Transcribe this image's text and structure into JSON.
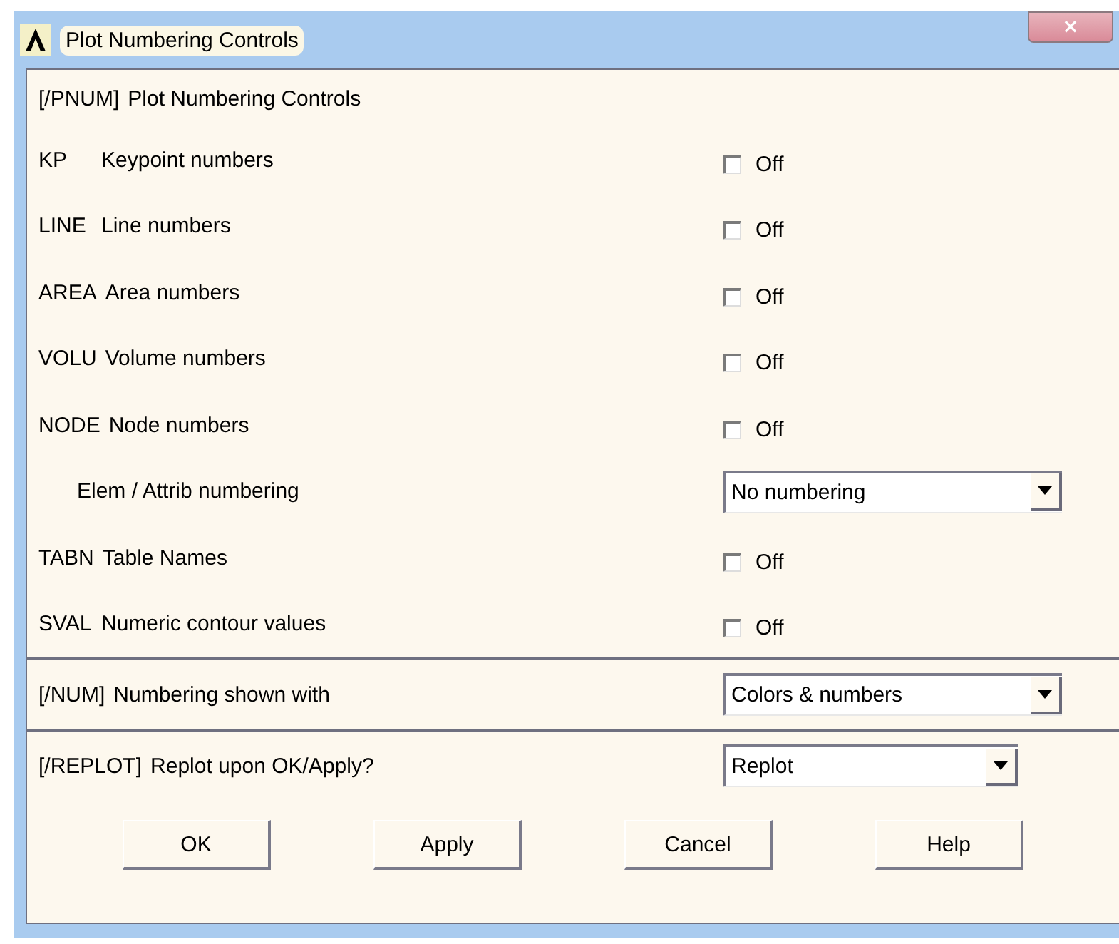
{
  "window": {
    "title": "Plot Numbering Controls",
    "close": "×"
  },
  "sections": [
    {
      "rows": [
        {
          "kind": "heading",
          "code": "[/PNUM]",
          "label": "Plot Numbering Controls"
        },
        {
          "kind": "checkbox",
          "code": "KP",
          "label": "Keypoint numbers",
          "checked": false,
          "text": "Off"
        },
        {
          "kind": "checkbox",
          "code": "LINE",
          "label": "Line numbers",
          "checked": false,
          "text": "Off"
        },
        {
          "kind": "checkbox",
          "code": "AREA",
          "label": "Area numbers",
          "checked": false,
          "text": "Off"
        },
        {
          "kind": "checkbox",
          "code": "VOLU",
          "label": "Volume numbers",
          "checked": false,
          "text": "Off"
        },
        {
          "kind": "checkbox",
          "code": "NODE",
          "label": "Node numbers",
          "checked": false,
          "text": "Off"
        },
        {
          "kind": "dropdown",
          "label": "Elem / Attrib numbering",
          "value": "No numbering"
        },
        {
          "kind": "checkbox",
          "code": "TABN",
          "label": "Table Names",
          "checked": false,
          "text": "Off"
        },
        {
          "kind": "checkbox",
          "code": "SVAL",
          "label": "Numeric contour values",
          "checked": false,
          "text": "Off"
        }
      ]
    },
    {
      "rows": [
        {
          "kind": "dropdown",
          "code": "[/NUM]",
          "label": "Numbering shown with",
          "value": "Colors & numbers"
        }
      ]
    },
    {
      "rows": [
        {
          "kind": "dropdown-short",
          "code": "[/REPLOT]",
          "label": "Replot upon OK/Apply?",
          "value": "Replot"
        }
      ],
      "buttons": [
        "OK",
        "Apply",
        "Cancel",
        "Help"
      ]
    }
  ]
}
